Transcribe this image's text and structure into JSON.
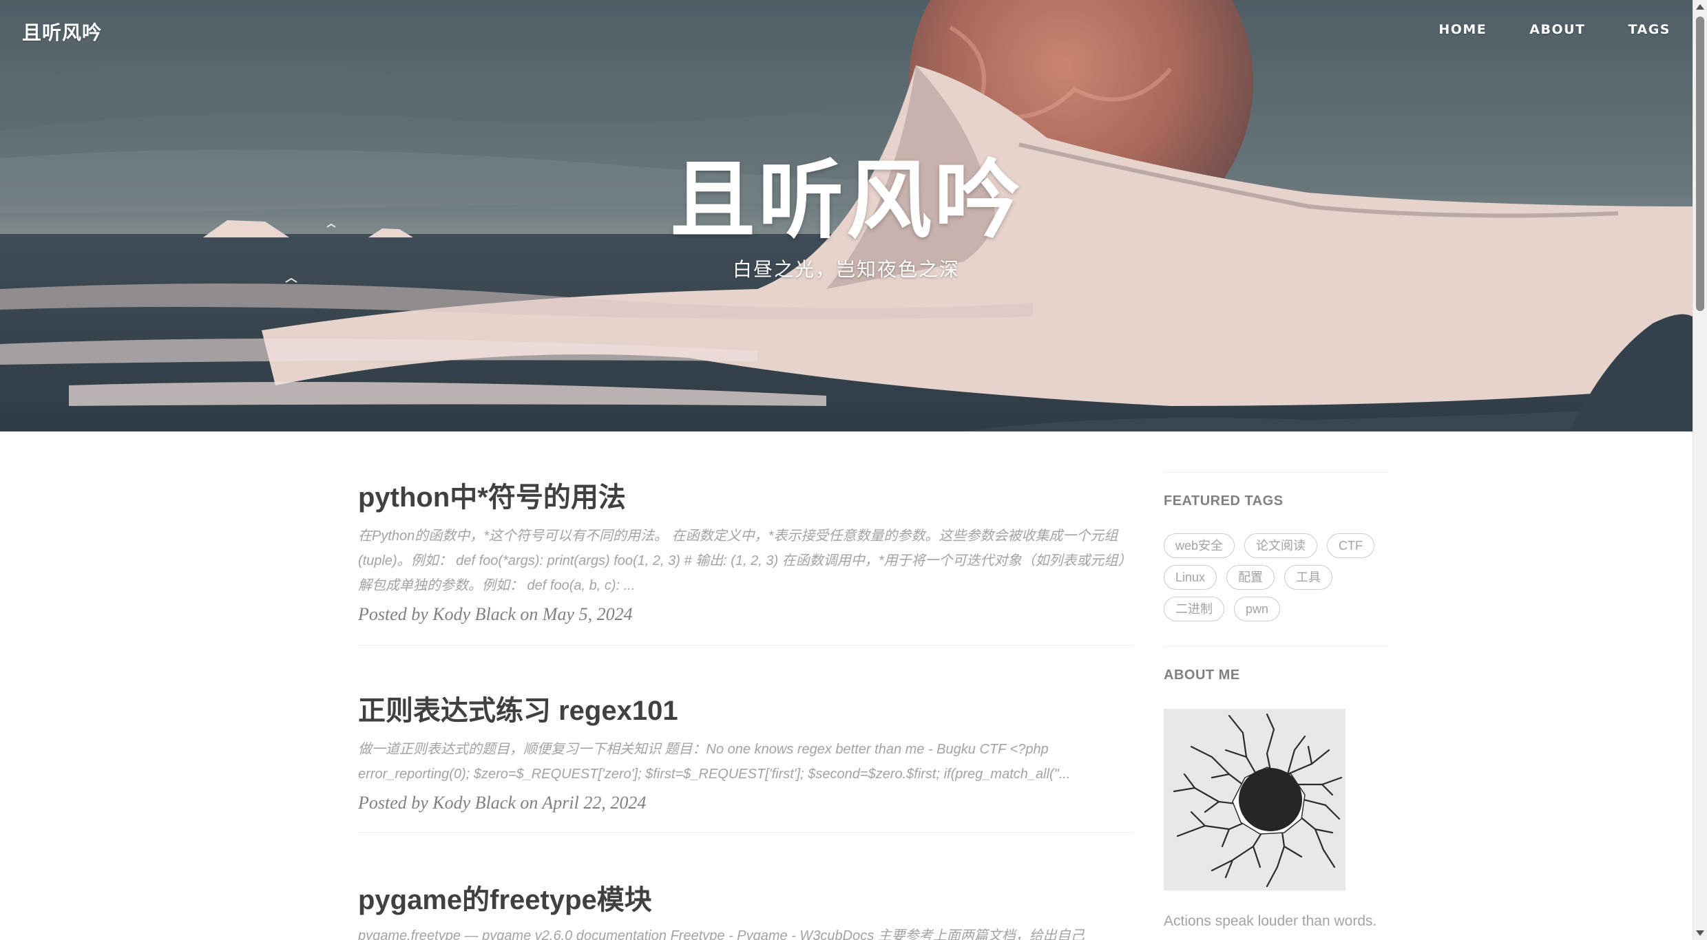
{
  "nav": {
    "brand": "且听风吟",
    "links": [
      "HOME",
      "ABOUT",
      "TAGS"
    ]
  },
  "hero": {
    "title": "且听风吟",
    "subtitle": "白昼之光，岂知夜色之深"
  },
  "posts": [
    {
      "title": "python中*符号的用法",
      "excerpt": "在Python的函数中，*这个符号可以有不同的用法。 在函数定义中，*表示接受任意数量的参数。这些参数会被收集成一个元组(tuple)。例如： def foo(*args): print(args) foo(1, 2, 3) # 输出: (1, 2, 3) 在函数调用中，*用于将一个可迭代对象（如列表或元组）解包成单独的参数。例如： def foo(a, b, c): ...",
      "meta": "Posted by Kody Black on May 5, 2024"
    },
    {
      "title": "正则表达式练习 regex101",
      "excerpt": "做一道正则表达式的题目，顺便复习一下相关知识 题目：No one knows regex better than me - Bugku CTF <?php error_reporting(0); $zero=$_REQUEST['zero']; $first=$_REQUEST['first']; $second=$zero.$first; if(preg_match_all(\"...",
      "meta": "Posted by Kody Black on April 22, 2024"
    },
    {
      "title": "pygame的freetype模块",
      "excerpt": "pygame.freetype — pygame v2.6.0 documentation Freetype - Pygame - W3cubDocs 主要参考上面两篇文档，给出自己"
    }
  ],
  "sidebar": {
    "featured_tags_heading": "FEATURED TAGS",
    "tags": [
      "web安全",
      "论文阅读",
      "CTF",
      "Linux",
      "配置",
      "工具",
      "二进制",
      "pwn"
    ],
    "about_heading": "ABOUT ME",
    "avatar_icon": "cracked-hole-icon",
    "about_text": "Actions speak louder than words."
  },
  "colors": {
    "title_text": "#404040",
    "excerpt_text": "#a3a3a3",
    "meta_text": "#808080",
    "tag_border": "#cccccc",
    "hero_planet": "#b0705e"
  }
}
